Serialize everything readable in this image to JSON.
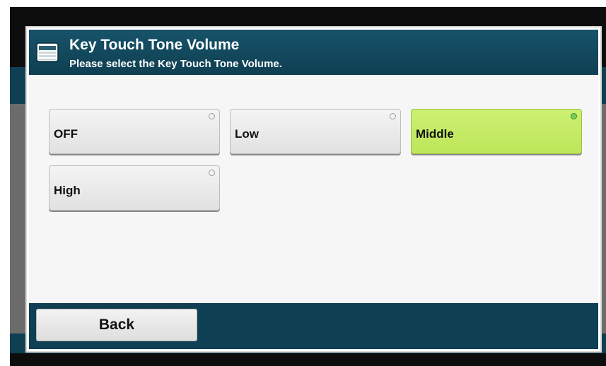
{
  "dialog": {
    "title": "Key Touch Tone Volume",
    "subtitle": "Please select the Key Touch Tone Volume.",
    "icon": "panel-display-icon"
  },
  "options": [
    {
      "label": "OFF",
      "selected": false
    },
    {
      "label": "Low",
      "selected": false
    },
    {
      "label": "Middle",
      "selected": true
    },
    {
      "label": "High",
      "selected": false
    }
  ],
  "footer": {
    "back_label": "Back"
  },
  "colors": {
    "header_bg": "#0f3f52",
    "selected_option": "#c8ee6a",
    "body_bg": "#f6f6f6"
  }
}
